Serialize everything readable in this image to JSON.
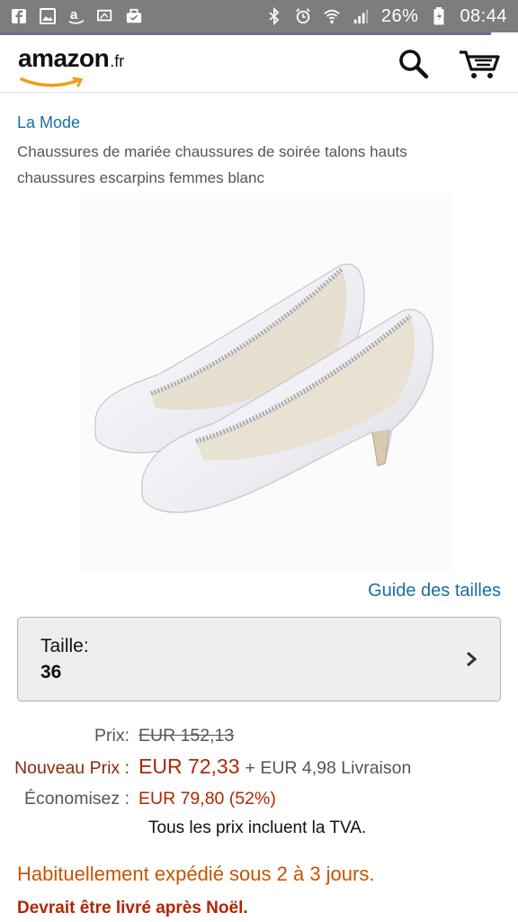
{
  "status_bar": {
    "battery": "26%",
    "time": "08:44",
    "left_icons": [
      "facebook-icon",
      "gallery-icon",
      "amazon-icon",
      "screen-icon",
      "briefcase-icon"
    ],
    "right_icons": [
      "bluetooth-icon",
      "alarm-icon",
      "wifi-icon",
      "signal-icon",
      "battery-icon"
    ]
  },
  "header": {
    "logo_main": "amazon",
    "logo_tld": ".fr",
    "search_icon": "search-icon",
    "cart_icon": "cart-icon"
  },
  "product": {
    "breadcrumb": "La Mode",
    "title": "Chaussures de mariée chaussures de soirée talons hauts chaussures escarpins femmes blanc",
    "image": "white-satin-pumps-image",
    "size_guide": "Guide des tailles",
    "size_label": "Taille:",
    "size_value": "36"
  },
  "pricing": {
    "list_label": "Prix:",
    "list_price": "EUR 152,13",
    "new_label": "Nouveau Prix :",
    "new_price": "EUR 72,33",
    "shipping": "+ EUR 4,98 Livraison",
    "save_label": "Économisez :",
    "save_value": "EUR 79,80 (52%)",
    "tva_note": "Tous les prix incluent la TVA."
  },
  "availability": {
    "ship_time": "Habituellement expédié sous 2 à 3 jours.",
    "delivery_note": "Devrait être livré après Noël."
  },
  "colors": {
    "status_bar": "#7d7d7d",
    "link": "#1a6fa3",
    "price": "#b12704",
    "availability": "#c45500",
    "amazon_orange": "#f29b1d"
  }
}
